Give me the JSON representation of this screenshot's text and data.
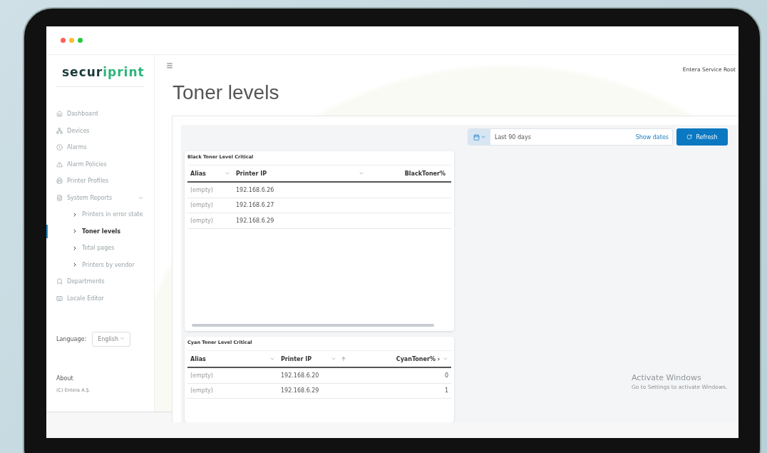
{
  "sidebar": {
    "logo_dark": "secur",
    "logo_accent": "iprint",
    "items": [
      {
        "label": "Dashboard",
        "selected": false
      },
      {
        "label": "Devices",
        "selected": false
      },
      {
        "label": "Alarms",
        "selected": false
      },
      {
        "label": "Alarm Policies",
        "selected": false
      },
      {
        "label": "Printer Profiles",
        "selected": false
      },
      {
        "label": "System Reports",
        "selected": false,
        "expanded": true,
        "children": [
          {
            "label": "Printers in error state",
            "selected": false
          },
          {
            "label": "Toner levels",
            "selected": true
          },
          {
            "label": "Total pages",
            "selected": false
          },
          {
            "label": "Printers by vendor",
            "selected": false
          }
        ]
      },
      {
        "label": "Departments",
        "selected": false
      },
      {
        "label": "Locale Editor",
        "selected": false
      }
    ],
    "language_label": "Language:",
    "language_value": "English",
    "about": "About",
    "copyright": "(C) Entera A.Ş."
  },
  "header": {
    "user": "Entera Service Root"
  },
  "page_title": "Toner levels",
  "date_filter": {
    "value": "Last 90 days",
    "link": "Show dates"
  },
  "refresh_button": "Refresh",
  "tables": [
    {
      "title": "Black Toner Level Critical",
      "columns": [
        {
          "label": "Alias",
          "menu": true,
          "sorted": false
        },
        {
          "label": "Printer IP",
          "menu": true,
          "sorted": false
        },
        {
          "label": "BlackToner%",
          "menu": false,
          "sorted": false
        }
      ],
      "rows": [
        [
          "(empty)",
          "192.168.6.26"
        ],
        [
          "(empty)",
          "192.168.6.27"
        ],
        [
          "(empty)",
          "192.168.6.29"
        ]
      ],
      "scrollbar": true
    },
    {
      "title": "Cyan Toner Level Critical",
      "columns": [
        {
          "label": "Alias",
          "menu": true,
          "sorted": false
        },
        {
          "label": "Printer IP",
          "menu": true,
          "sorted": true
        },
        {
          "label": "CyanToner% ›",
          "menu": true,
          "sorted": false
        }
      ],
      "rows": [
        [
          "(empty)",
          "192.168.6.20",
          "0"
        ],
        [
          "(empty)",
          "192.168.6.29",
          "1"
        ]
      ],
      "scrollbar": false
    }
  ],
  "os_notice": {
    "title": "Activate Windows",
    "subtitle": "Go to Settings to activate Windows."
  }
}
